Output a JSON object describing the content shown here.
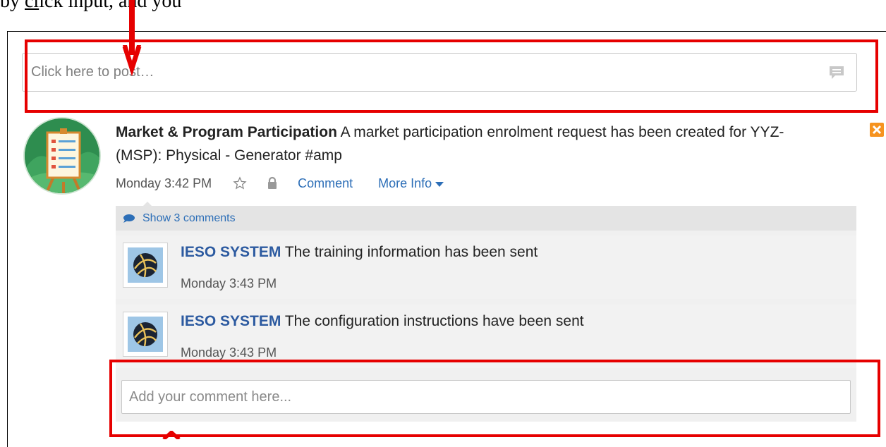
{
  "document_text": {
    "prefix": "by",
    "underlined": "cl",
    "suffix": "ick input, and you"
  },
  "post_box": {
    "placeholder": "Click here to post…",
    "icon": "speech-bubble-icon"
  },
  "post": {
    "author": "Market & Program Participation",
    "text": "A market participation enrolment request has been created for YYZ-(MSP): Physical - Generator #amp",
    "time": "Monday 3:42 PM",
    "actions": {
      "comment": "Comment",
      "more_info": "More Info"
    },
    "icons": [
      "star-icon",
      "lock-icon",
      "close-icon"
    ]
  },
  "comments_section": {
    "show_comments": "Show 3 comments",
    "comments": [
      {
        "author": "IESO SYSTEM",
        "text": "The training information has been sent",
        "time": "Monday 3:43 PM"
      },
      {
        "author": "IESO SYSTEM",
        "text": "The configuration instructions have been sent",
        "time": "Monday 3:43 PM"
      }
    ],
    "add_comment_placeholder": "Add your comment here..."
  },
  "colors": {
    "link": "#2c6eb7",
    "author_link": "#2c5aa0",
    "annotation_red": "#e60000",
    "close_orange": "#f6931f"
  }
}
